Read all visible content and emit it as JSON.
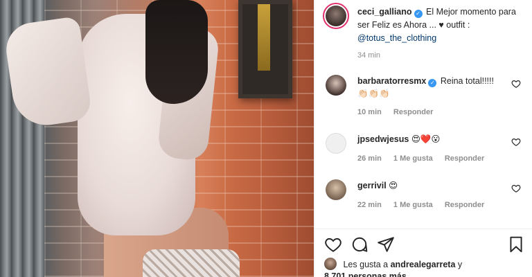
{
  "post": {
    "author": "ceci_galliano",
    "caption_text": "El Mejor momento para ser Feliz es Ahora ... ♥ outfit :",
    "caption_mention": "@totus_the_clothing",
    "time": "34 min"
  },
  "comments": [
    {
      "user": "barbaratorresmx",
      "verified": true,
      "text": "Reina total!!!!!",
      "emoji": "👏🏻👏🏻👏🏻",
      "time": "10 min",
      "likes": "",
      "reply": "Responder"
    },
    {
      "user": "jpsedwjesus",
      "verified": false,
      "text": "😍❤️😮",
      "time": "26 min",
      "likes": "1 Me gusta",
      "reply": "Responder"
    },
    {
      "user": "gerrivil",
      "verified": false,
      "text": "😍",
      "time": "22 min",
      "likes": "1 Me gusta",
      "reply": "Responder"
    }
  ],
  "likes": {
    "prefix": "Les gusta a",
    "user": "andrealegarreta",
    "joiner": "y",
    "count": "8.701 personas más"
  },
  "icons": {
    "like": "heart-icon",
    "comment": "comment-icon",
    "share": "share-icon",
    "save": "bookmark-icon"
  }
}
